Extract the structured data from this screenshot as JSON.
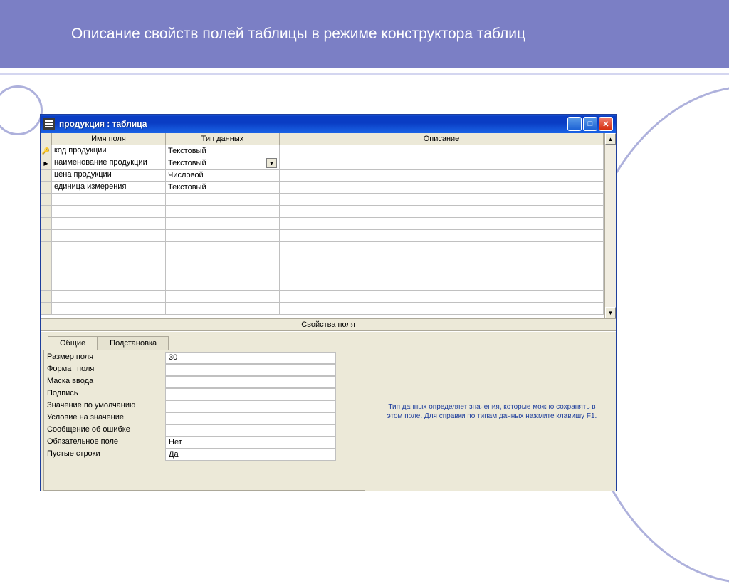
{
  "slide": {
    "title": "Описание свойств полей таблицы в режиме конструктора таблиц"
  },
  "window": {
    "title": "продукция : таблица"
  },
  "grid": {
    "headers": {
      "name": "Имя поля",
      "type": "Тип данных",
      "desc": "Описание"
    },
    "rows": [
      {
        "selector": "key",
        "name": "код продукции",
        "type": "Текстовый",
        "dropdown": false
      },
      {
        "selector": "arrow",
        "name": "наименование продукции",
        "type": "Текстовый",
        "dropdown": true
      },
      {
        "selector": "",
        "name": "цена продукции",
        "type": "Числовой",
        "dropdown": false
      },
      {
        "selector": "",
        "name": "единица измерения",
        "type": "Текстовый",
        "dropdown": false
      }
    ]
  },
  "splitter": "Свойства поля",
  "tabs": {
    "general": "Общие",
    "lookup": "Подстановка"
  },
  "props": [
    {
      "label": "Размер поля",
      "value": "30"
    },
    {
      "label": "Формат поля",
      "value": ""
    },
    {
      "label": "Маска ввода",
      "value": ""
    },
    {
      "label": "Подпись",
      "value": ""
    },
    {
      "label": "Значение по умолчанию",
      "value": ""
    },
    {
      "label": "Условие на значение",
      "value": ""
    },
    {
      "label": "Сообщение об ошибке",
      "value": ""
    },
    {
      "label": "Обязательное поле",
      "value": "Нет"
    },
    {
      "label": "Пустые строки",
      "value": "Да"
    }
  ],
  "help": "Тип данных определяет значения, которые можно сохранять в этом поле. Для справки по типам данных нажмите клавишу F1."
}
